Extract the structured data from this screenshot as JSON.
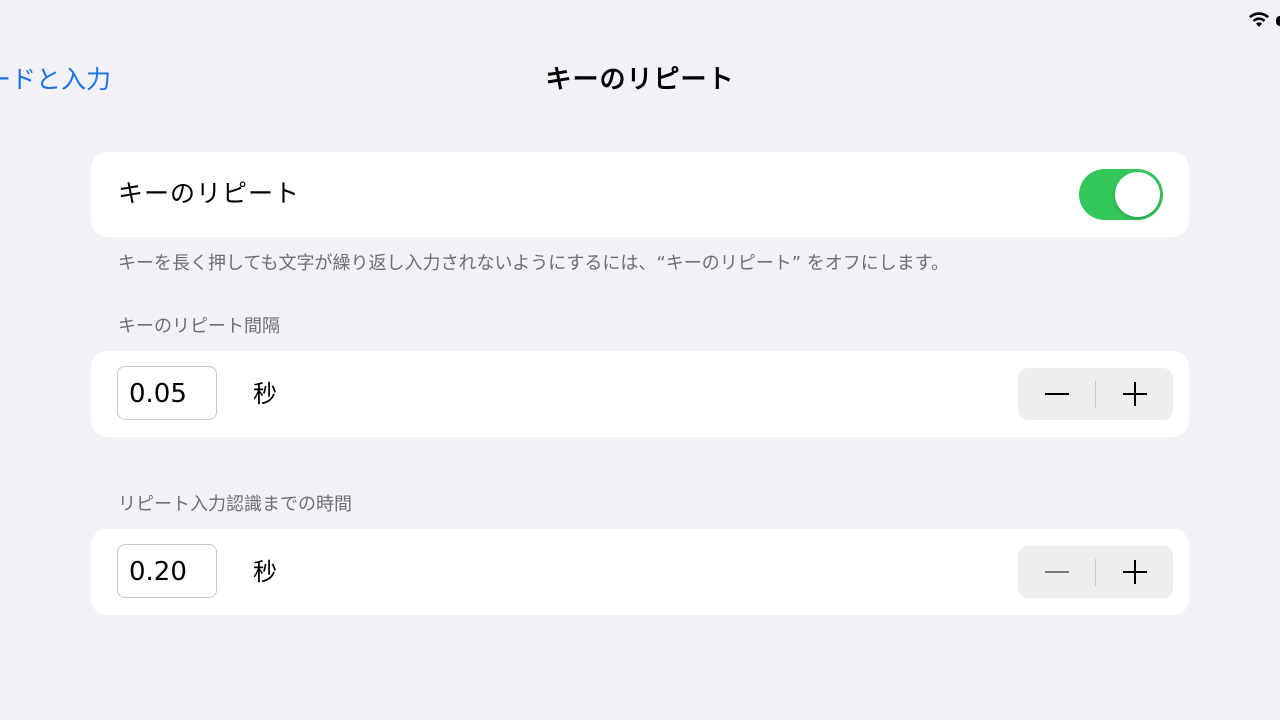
{
  "nav": {
    "back_label": "ードと入力",
    "title": "キーのリピート"
  },
  "toggle_section": {
    "label": "キーのリピート",
    "enabled": true,
    "footer": "キーを長く押しても文字が繰り返し入力されないようにするには、“キーのリピート” をオフにします。"
  },
  "repeat_interval": {
    "header": "キーのリピート間隔",
    "value": "0.05",
    "unit": "秒"
  },
  "repeat_delay": {
    "header": "リピート入力認識までの時間",
    "value": "0.20",
    "unit": "秒"
  },
  "colors": {
    "accent": "#1a73e8",
    "switch_on": "#34c759",
    "background": "#f2f1f7"
  }
}
